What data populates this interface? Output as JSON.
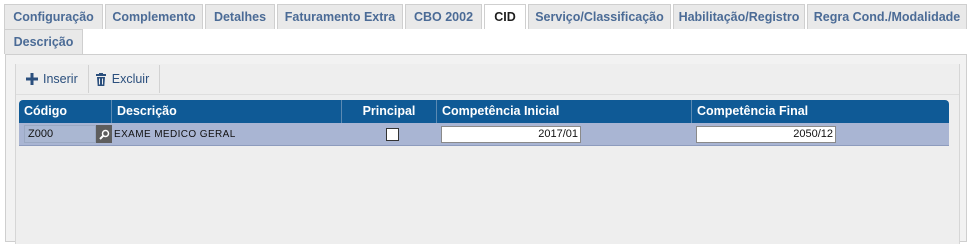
{
  "tabs": [
    {
      "label": "Configuração",
      "active": false
    },
    {
      "label": "Complemento",
      "active": false
    },
    {
      "label": "Detalhes",
      "active": false
    },
    {
      "label": "Faturamento Extra",
      "active": false
    },
    {
      "label": "CBO 2002",
      "active": false
    },
    {
      "label": "CID",
      "active": true
    },
    {
      "label": "Serviço/Classificação",
      "active": false
    },
    {
      "label": "Habilitação/Registro",
      "active": false
    },
    {
      "label": "Regra Cond./Modalidade",
      "active": false
    },
    {
      "label": "Descrição",
      "active": false
    }
  ],
  "toolbar": {
    "insert_label": "Inserir",
    "insert_icon": "plus-icon",
    "delete_label": "Excluir",
    "delete_icon": "trash-icon"
  },
  "grid": {
    "columns": {
      "codigo": "Código",
      "descricao": "Descrição",
      "principal": "Principal",
      "competencia_inicial": "Competência Inicial",
      "competencia_final": "Competência Final"
    },
    "rows": [
      {
        "codigo": "Z000",
        "descricao": "EXAME MEDICO GERAL",
        "principal": false,
        "competencia_inicial": "2017/01",
        "competencia_final": "2050/12"
      }
    ]
  },
  "colors": {
    "header_bg": "#0f5a96",
    "row_bg": "#a9b5d3",
    "tab_text": "#4b6b96"
  }
}
